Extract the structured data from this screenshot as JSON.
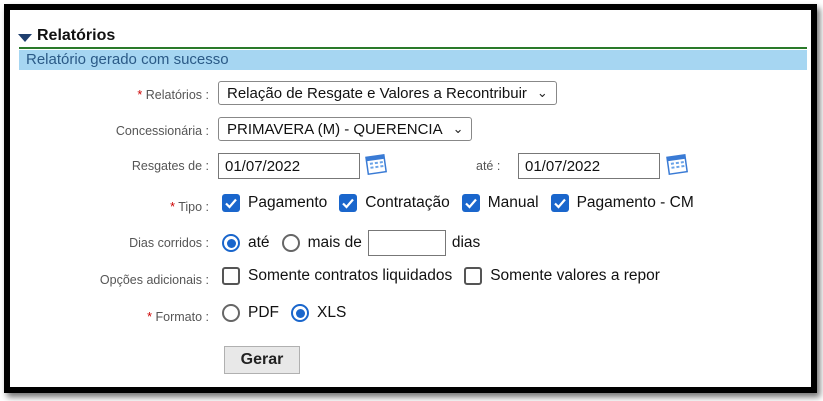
{
  "section": {
    "title": "Relatórios"
  },
  "message": "Relatório gerado com sucesso",
  "form": {
    "relatorios": {
      "label": "Relatórios :",
      "value": "Relação de Resgate e Valores a Recontribuir"
    },
    "concessionaria": {
      "label": "Concessionária :",
      "value": "PRIMAVERA (M) - QUERENCIA"
    },
    "resgates": {
      "label": "Resgates de :",
      "from": "01/07/2022",
      "to_label": "até :",
      "to": "01/07/2022"
    },
    "tipo": {
      "label": "Tipo :",
      "options": [
        {
          "label": "Pagamento",
          "checked": true
        },
        {
          "label": "Contratação",
          "checked": true
        },
        {
          "label": "Manual",
          "checked": true
        },
        {
          "label": "Pagamento - CM",
          "checked": true
        }
      ]
    },
    "dias": {
      "label": "Dias corridos :",
      "opt1": "até",
      "opt2": "mais de",
      "value": "",
      "unit": "dias",
      "selected": "até"
    },
    "opcoes": {
      "label": "Opções adicionais :",
      "options": [
        {
          "label": "Somente contratos liquidados",
          "checked": false
        },
        {
          "label": "Somente valores a repor",
          "checked": false
        }
      ]
    },
    "formato": {
      "label": "Formato :",
      "opt1": "PDF",
      "opt2": "XLS",
      "selected": "XLS"
    },
    "required_mark": "*",
    "submit": "Gerar"
  },
  "colors": {
    "accent": "#1a66cc",
    "message_bg": "#a6d6f2",
    "rule": "#2a7a2a"
  }
}
